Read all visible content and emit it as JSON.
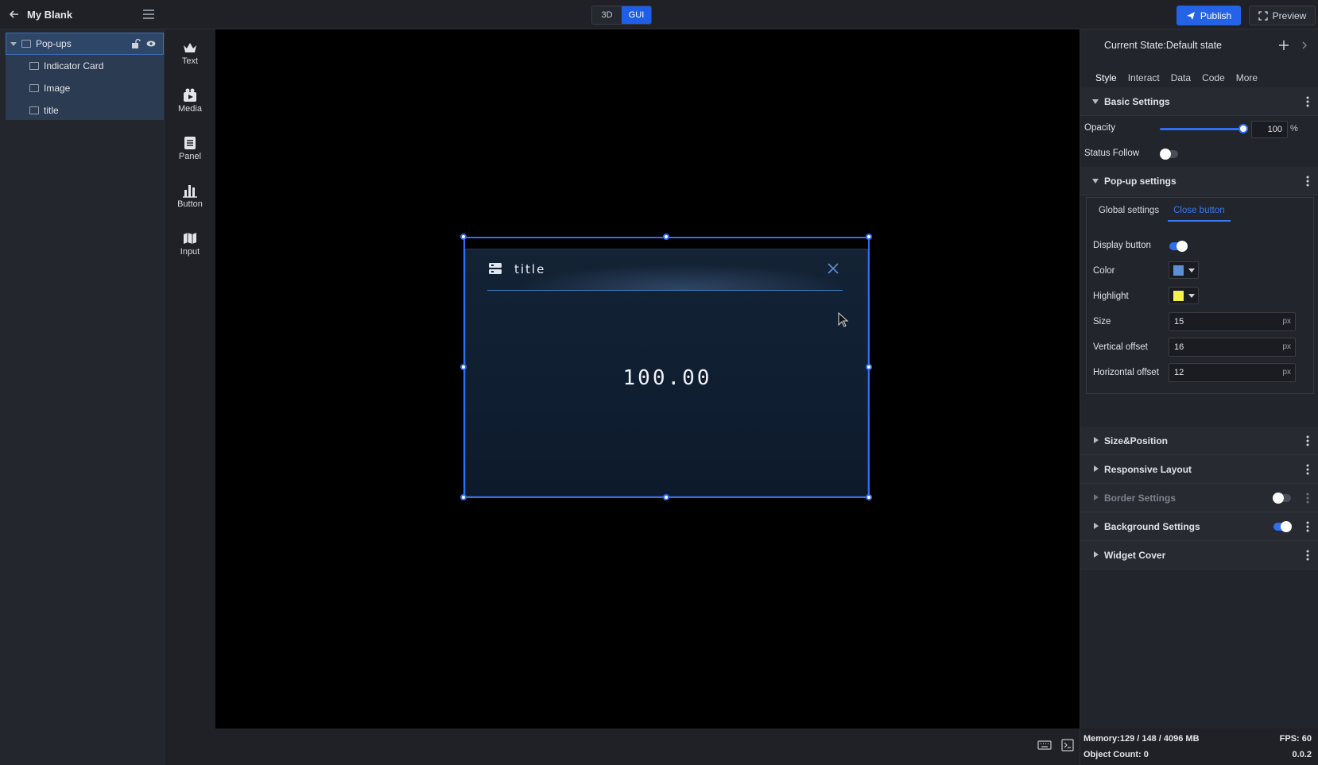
{
  "app": {
    "title": "My Blank"
  },
  "mode": {
    "options": [
      "3D",
      "GUI"
    ],
    "active": "GUI"
  },
  "toolbar": {
    "publish": "Publish",
    "preview": "Preview"
  },
  "layers": {
    "group": {
      "label": "Pop-ups"
    },
    "children": [
      {
        "label": "Indicator Card",
        "icon": "indicator-icon"
      },
      {
        "label": "Image",
        "icon": "image-icon"
      },
      {
        "label": "title",
        "icon": "text-layer-icon"
      }
    ]
  },
  "widgets": [
    {
      "label": "Text",
      "icon": "text-widget-icon"
    },
    {
      "label": "Media",
      "icon": "media-widget-icon"
    },
    {
      "label": "Panel",
      "icon": "panel-widget-icon"
    },
    {
      "label": "Button",
      "icon": "button-widget-icon"
    },
    {
      "label": "Input",
      "icon": "input-widget-icon"
    }
  ],
  "popup": {
    "title": "title",
    "value": "100.00"
  },
  "properties": {
    "state": "Current State:Default state",
    "tabs": [
      "Style",
      "Interact",
      "Data",
      "Code",
      "More"
    ],
    "active_tab": "Style",
    "basic_settings": {
      "label": "Basic Settings",
      "opacity_label": "Opacity",
      "opacity_value": "100",
      "opacity_fraction": 1.0,
      "opacity_unit": "%",
      "status_follow_label": "Status Follow",
      "status_follow": false
    },
    "popup_settings": {
      "label": "Pop-up settings",
      "subtabs": [
        "Global settings",
        "Close button"
      ],
      "active_subtab": "Close button",
      "display_button_label": "Display button",
      "display_button": true,
      "color_label": "Color",
      "color_value": "#5b8fd6",
      "highlight_label": "Highlight",
      "highlight_value": "#f5f04a",
      "size_label": "Size",
      "size_value": "15",
      "vertical_offset_label": "Vertical offset",
      "vertical_offset_value": "16",
      "horizontal_offset_label": "Horizontal offset",
      "horizontal_offset_value": "12",
      "unit": "px"
    },
    "sections": [
      {
        "label": "Size&Position",
        "toggle": null,
        "dim": false
      },
      {
        "label": "Responsive Layout",
        "toggle": null,
        "dim": false
      },
      {
        "label": "Border Settings",
        "toggle": false,
        "dim": true
      },
      {
        "label": "Background Settings",
        "toggle": true,
        "dim": false
      },
      {
        "label": "Widget Cover",
        "toggle": null,
        "dim": false
      }
    ]
  },
  "status": {
    "memory": "Memory:129 / 148 / 4096 MB",
    "fps": "FPS: 60",
    "object_count": "Object Count: 0",
    "version": "0.0.2"
  },
  "colors": {
    "accent": "#2f6ef0",
    "canvas": "#000000",
    "panel": "#22252b"
  }
}
